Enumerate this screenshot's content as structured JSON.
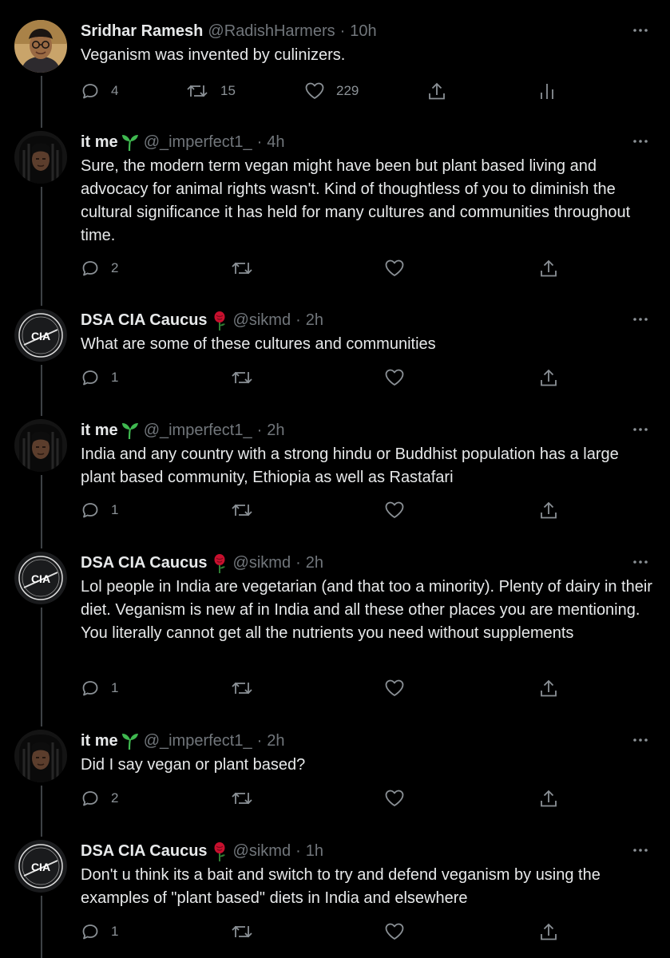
{
  "tweets": [
    {
      "name": "Sridhar Ramesh",
      "handle": "@RadishHarmers",
      "time": "10h",
      "text": "Veganism was invented by culinizers.",
      "reply_count": "4",
      "retweet_count": "15",
      "like_count": "229",
      "avatar": "photo-portrait-glasses",
      "has_sprout": false,
      "has_rose": false
    },
    {
      "name": "it me",
      "handle": "@_imperfect1_",
      "time": "4h",
      "text": "Sure, the modern term vegan might have been but plant based living and advocacy for animal rights wasn't. Kind of thoughtless of you to diminish the cultural significance it has held for many cultures and communities throughout time.",
      "reply_count": "2",
      "retweet_count": "",
      "like_count": "",
      "avatar": "photo-portrait-dreadlocks",
      "has_sprout": true,
      "has_rose": false
    },
    {
      "name": "DSA CIA Caucus",
      "handle": "@sikmd",
      "time": "2h",
      "text": "What are some of these cultures and communities",
      "reply_count": "1",
      "retweet_count": "",
      "like_count": "",
      "avatar": "cia-seal-logo",
      "has_sprout": false,
      "has_rose": true
    },
    {
      "name": "it me",
      "handle": "@_imperfect1_",
      "time": "2h",
      "text": "India and any country with a strong hindu or Buddhist population has a large plant based community, Ethiopia as well as Rastafari",
      "reply_count": "1",
      "retweet_count": "",
      "like_count": "",
      "avatar": "photo-portrait-dreadlocks",
      "has_sprout": true,
      "has_rose": false
    },
    {
      "name": "DSA CIA Caucus",
      "handle": "@sikmd",
      "time": "2h",
      "text": "Lol people in India are vegetarian (and that too a minority). Plenty of dairy in their diet. Veganism is new af in India and all these other places you are mentioning. You literally cannot get all the nutrients you need without supplements",
      "reply_count": "1",
      "retweet_count": "",
      "like_count": "",
      "avatar": "cia-seal-logo",
      "has_sprout": false,
      "has_rose": true
    },
    {
      "name": "it me",
      "handle": "@_imperfect1_",
      "time": "2h",
      "text": "Did I say vegan or plant based?",
      "reply_count": "2",
      "retweet_count": "",
      "like_count": "",
      "avatar": "photo-portrait-dreadlocks",
      "has_sprout": true,
      "has_rose": false
    },
    {
      "name": "DSA CIA Caucus",
      "handle": "@sikmd",
      "time": "1h",
      "text": "Don't u think its a bait and switch to try and defend veganism by using the examples of \"plant based\" diets in India and elsewhere",
      "reply_count": "1",
      "retweet_count": "",
      "like_count": "",
      "avatar": "cia-seal-logo",
      "has_sprout": false,
      "has_rose": true
    }
  ],
  "cia_logo_text": "CIA",
  "icons": {
    "reply": "reply-icon",
    "retweet": "retweet-icon",
    "like": "heart-icon",
    "share": "share-icon",
    "analytics": "analytics-icon",
    "more": "more-options-icon"
  },
  "colors": {
    "background": "#000000",
    "text": "#e7e9ea",
    "muted": "#71767b",
    "sprout": "#3fb950",
    "rose": "#c8102e"
  }
}
